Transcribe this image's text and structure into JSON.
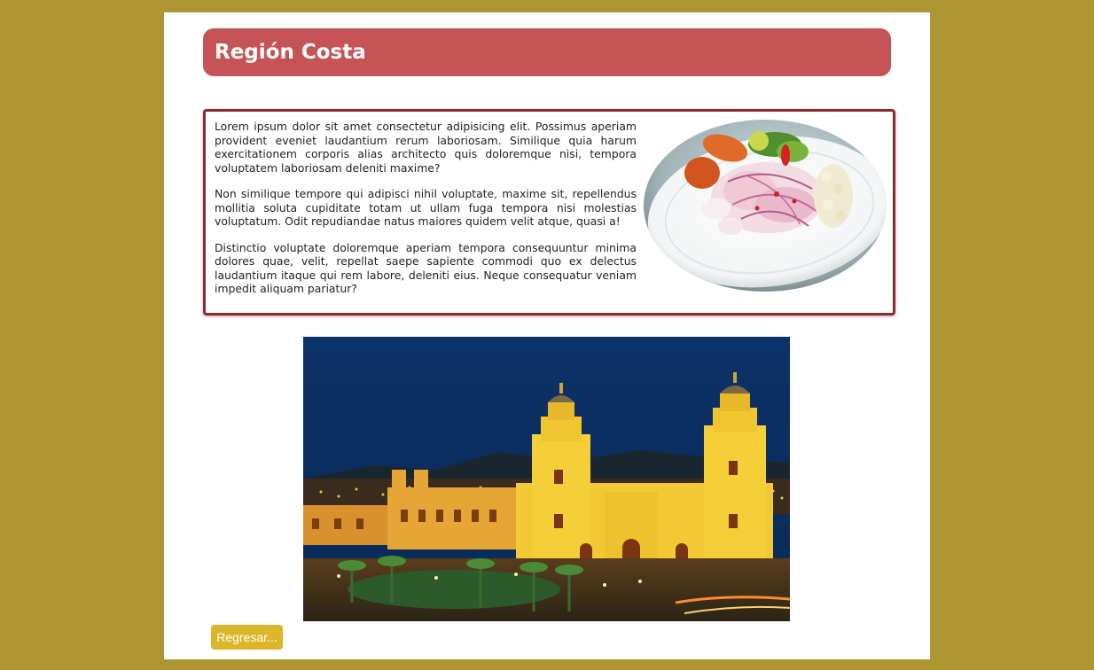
{
  "header": {
    "title": "Región Costa"
  },
  "article": {
    "paragraphs": [
      "Lorem ipsum dolor sit amet consectetur adipisicing elit. Possimus aperiam provident eveniet laudantium rerum laboriosam. Similique quia harum exercitationem corporis alias architecto quis doloremque nisi, tempora voluptatem laboriosam deleniti maxime?",
      "Non similique tempore qui adipisci nihil voluptate, maxime sit, repellendus mollitia soluta cupiditate totam ut ullam fuga tempora nisi molestias voluptatum. Odit repudiandae natus maiores quidem velit atque, quasi a!",
      "Distinctio voluptate doloremque aperiam tempora consequuntur minima dolores quae, velit, repellat saepe sapiente commodi quo ex delectus laudantium itaque qui rem labore, deleniti eius. Neque consequatur veniam impedit aliquam pariatur?"
    ]
  },
  "images": {
    "dish": "ceviche-plate",
    "photo": "lima-cathedral-at-night"
  },
  "actions": {
    "back_label": "Regresar..."
  },
  "colors": {
    "background": "#ae9733",
    "header": "#c65457",
    "box_border": "#8a2c30",
    "button": "#dcb62a"
  }
}
